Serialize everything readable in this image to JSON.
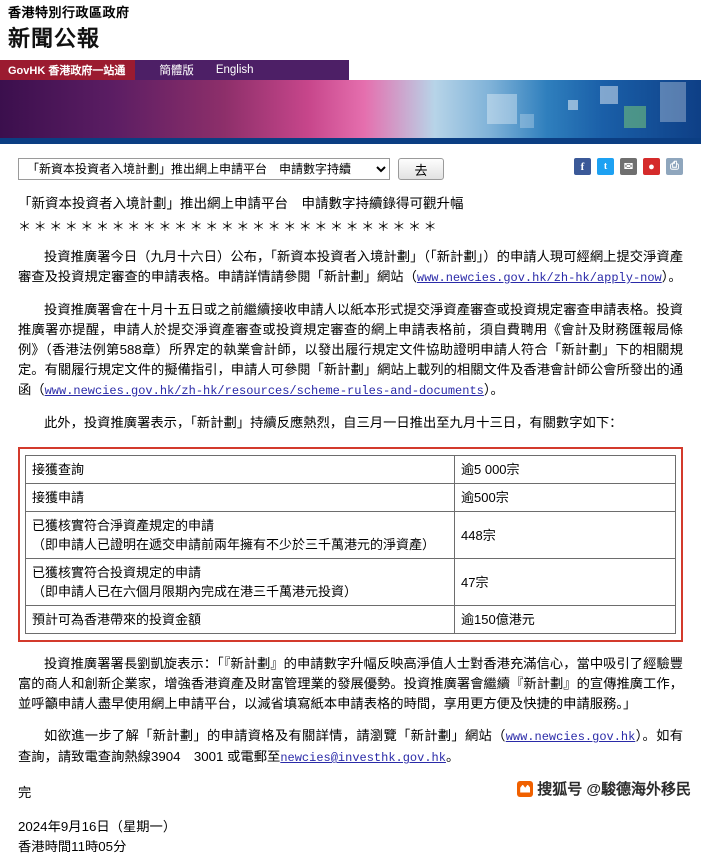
{
  "header": {
    "gov_name": "香港特別行政區政府",
    "page_title": "新聞公報"
  },
  "nav": {
    "brand": "GovHK 香港政府一站通",
    "links": [
      {
        "label": "簡體版"
      },
      {
        "label": "English"
      }
    ]
  },
  "toolbar": {
    "archive_selected": "「新資本投資者入境計劃」推出網上申請平台　申請數字持續",
    "go_label": "去",
    "share": [
      {
        "name": "facebook-icon",
        "glyph": "f"
      },
      {
        "name": "twitter-icon",
        "glyph": "t"
      },
      {
        "name": "email-icon",
        "glyph": "✉"
      },
      {
        "name": "weibo-icon",
        "glyph": "●"
      },
      {
        "name": "print-icon",
        "glyph": "⎙"
      }
    ]
  },
  "article": {
    "headline": "「新資本投資者入境計劃」推出網上申請平台　申請數字持續錄得可觀升幅",
    "stars": "＊＊＊＊＊＊＊＊＊＊＊＊＊＊＊＊＊＊＊＊＊＊＊＊＊＊＊",
    "para1_a": "投資推廣署今日（九月十六日）公布，「新資本投資者入境計劃」（「新計劃」）的申請人現可經網上提交淨資產審查及投資規定審查的申請表格。申請詳情請參閱「新計劃」網站（",
    "para1_link": "www.newcies.gov.hk/zh-hk/apply-now",
    "para1_b": "）。",
    "para2_a": "投資推廣署會在十月十五日或之前繼續接收申請人以紙本形式提交淨資產審查或投資規定審查申請表格。投資推廣署亦提醒，申請人於提交淨資產審查或投資規定審查的網上申請表格前，須自費聘用《會計及財務匯報局條例》（香港法例第588章）所界定的執業會計師，以發出履行規定文件協助證明申請人符合「新計劃」下的相關規定。有關履行規定文件的擬備指引，申請人可參閱「新計劃」網站上載列的相關文件及香港會計師公會所發出的通函（",
    "para2_link": "www.newcies.gov.hk/zh-hk/resources/scheme-rules-and-documents",
    "para2_b": "）。",
    "para3": "此外，投資推廣署表示，「新計劃」持續反應熱烈，自三月一日推出至九月十三日，有關數字如下：",
    "para4": "投資推廣署署長劉凱旋表示：「『新計劃』的申請數字升幅反映高淨值人士對香港充滿信心，當中吸引了經驗豐富的商人和創新企業家，增強香港資產及財富管理業的發展優勢。投資推廣署會繼續『新計劃』的宣傳推廣工作，並呼籲申請人盡早使用網上申請平台，以減省填寫紙本申請表格的時間，享用更方便及快捷的申請服務。」",
    "para5_a": "如欲進一步了解「新計劃」的申請資格及有關詳情，請瀏覽「新計劃」網站（",
    "para5_link": "www.newcies.gov.hk",
    "para5_b": "）。如有查詢，請致電查詢熱線3904　3001 或電郵至",
    "para5_email": "newcies@investhk.gov.hk",
    "para5_c": "。",
    "end_mark": "完",
    "date_line": "2024年9月16日（星期一）",
    "time_line": "香港時間11時05分"
  },
  "stats_table": {
    "rows": [
      {
        "label": "接獲查詢",
        "sub": "",
        "value": "逾5 000宗"
      },
      {
        "label": "接獲申請",
        "sub": "",
        "value": "逾500宗"
      },
      {
        "label": "已獲核實符合淨資產規定的申請",
        "sub": "（即申請人已證明在遞交申請前兩年擁有不少於三千萬港元的淨資產）",
        "value": "448宗"
      },
      {
        "label": "已獲核實符合投資規定的申請",
        "sub": "（即申請人已在六個月限期內完成在港三千萬港元投資）",
        "value": "47宗"
      },
      {
        "label": "預計可為香港帶來的投資金額",
        "sub": "",
        "value": "逾150億港元"
      }
    ]
  },
  "watermark": {
    "text": "搜狐号 @駿德海外移民"
  }
}
